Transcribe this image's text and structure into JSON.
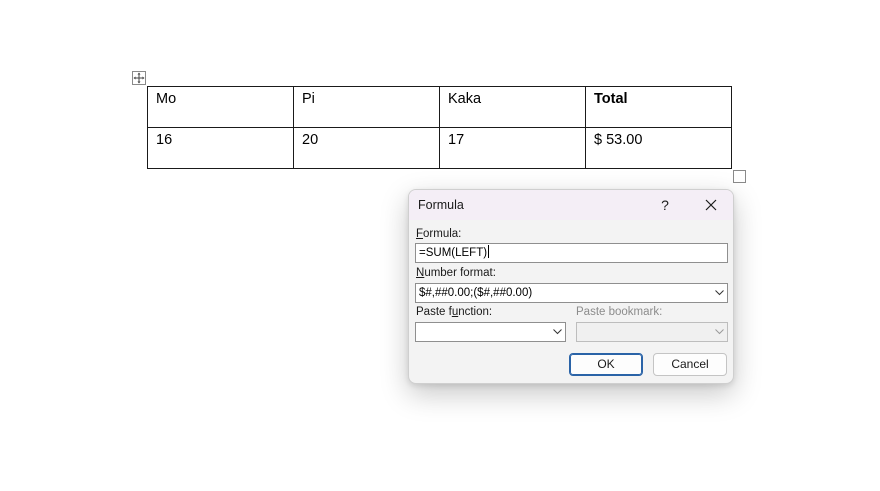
{
  "table": {
    "headers": [
      "Mo",
      "Pi",
      "Kaka",
      "Total"
    ],
    "values": [
      "16",
      "20",
      "17",
      "$  53.00"
    ]
  },
  "dialog": {
    "title": "Formula",
    "help_label": "?",
    "close_icon": "close-icon",
    "formula_label_accel": "F",
    "formula_label_rest": "ormula:",
    "formula_value": "=SUM(LEFT)",
    "number_format_label_accel": "N",
    "number_format_label_rest": "umber format:",
    "number_format_value": "$#,##0.00;($#,##0.00)",
    "paste_function_label_pre": "Paste f",
    "paste_function_label_accel": "u",
    "paste_function_label_post": "nction:",
    "paste_function_value": "",
    "paste_bookmark_label": "Paste bookmark:",
    "paste_bookmark_value": "",
    "ok_label": "OK",
    "cancel_label": "Cancel"
  }
}
